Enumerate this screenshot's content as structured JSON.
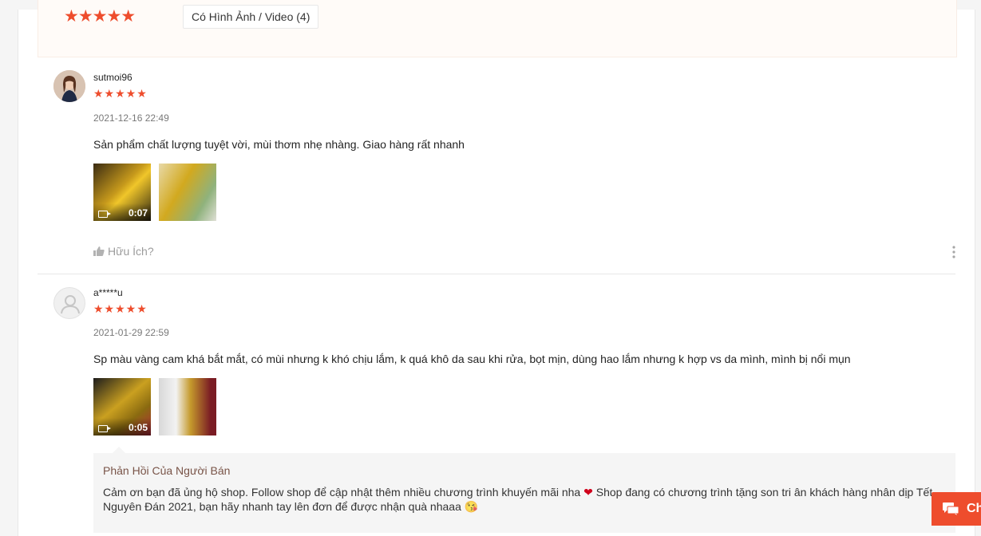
{
  "filter": {
    "rating_stars": "★★★★★",
    "chip_label": "Có Hình Ảnh / Video (4)"
  },
  "reviews": [
    {
      "username": "sutmoi96",
      "stars": "★★★★★",
      "date": "2021-12-16 22:49",
      "comment": "Sản phẩm chất lượng tuyệt vời,  mùi thơm nhẹ nhàng. Giao hàng rất nhanh",
      "video_duration": "0:07",
      "like_label": "Hữu Ích?"
    },
    {
      "username": "a*****u",
      "stars": "★★★★★",
      "date": "2021-01-29 22:59",
      "comment": "Sp màu vàng cam khá bắt mắt, có mùi nhưng k khó chịu lắm, k quá khô da sau khi rửa, bọt mịn, dùng hao lắm nhưng k hợp vs da mình, mình bị nổi mụn",
      "video_duration": "0:05"
    }
  ],
  "seller_reply": {
    "title": "Phản Hồi Của Người Bán",
    "text_part1": "Cảm ơn bạn đã ủng hộ shop. Follow shop để cập nhật thêm nhiều chương trình khuyến mãi nha ",
    "heart_emoji": "❤",
    "text_part2": " Shop đang có chương trình tặng son tri ân khách hàng nhân dịp Tết Nguyên Đán 2021, bạn hãy nhanh tay lên đơn để được nhận quà nhaaa ",
    "wink_emoji": "😘"
  },
  "chat": {
    "label": "Ch"
  },
  "colors": {
    "accent": "#ee4d2d",
    "reply_title": "#795448"
  }
}
